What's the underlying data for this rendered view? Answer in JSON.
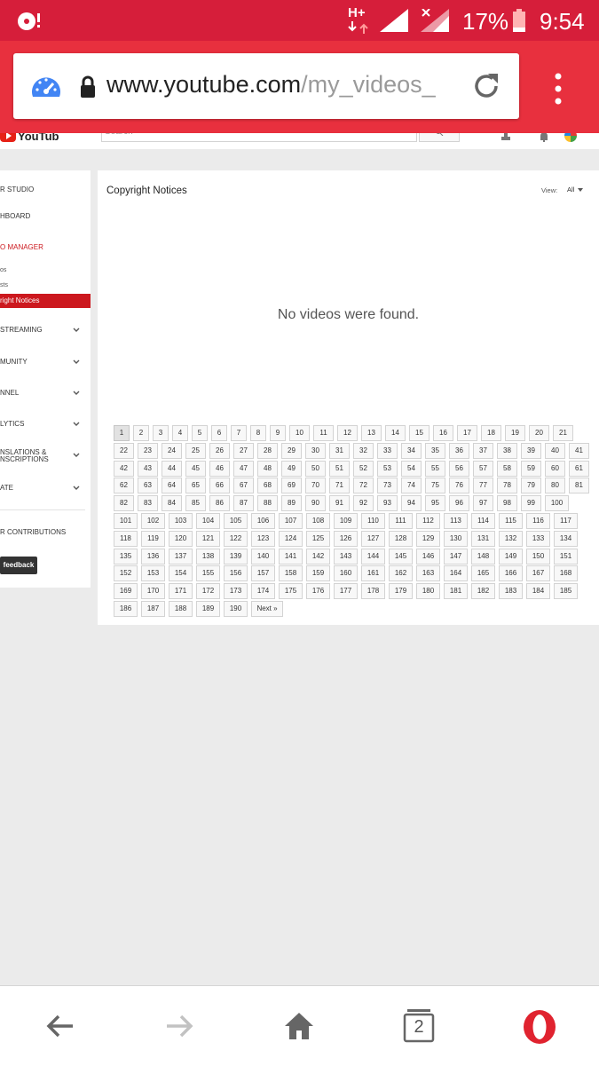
{
  "status_bar": {
    "network": "H+",
    "battery": "17%",
    "time": "9:54"
  },
  "browser": {
    "url_domain": "www.youtube.com",
    "url_path": "/my_videos_",
    "tab_count": "2"
  },
  "yt_header": {
    "logo_text": "YouTube",
    "search_placeholder": "Search"
  },
  "sidebar": {
    "studio": "R STUDIO",
    "dashboard": "HBOARD",
    "video_manager": "O MANAGER",
    "sub_videos": "os",
    "sub_playlists": "sts",
    "sub_copyright": "right Notices",
    "live": "STREAMING",
    "community": "MUNITY",
    "channel": "NNEL",
    "analytics": "LYTICS",
    "translations_1": "NSLATIONS &",
    "translations_2": "NSCRIPTIONS",
    "create": "ATE",
    "contributions": "R CONTRIBUTIONS",
    "feedback": "feedback"
  },
  "main": {
    "title": "Copyright Notices",
    "view_label": "View:",
    "view_value": "All",
    "empty_message": "No videos were found.",
    "next_label": "Next »"
  },
  "pagination": {
    "current": 1,
    "total_pages": 190
  }
}
